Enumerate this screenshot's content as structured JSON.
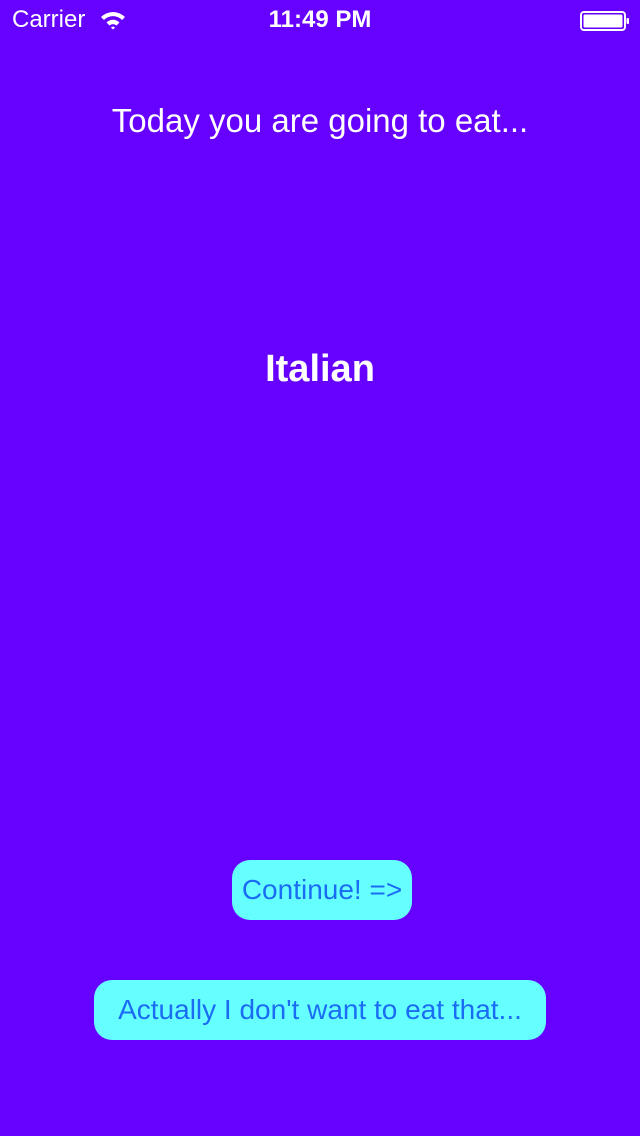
{
  "status_bar": {
    "carrier": "Carrier",
    "time": "11:49 PM",
    "wifi_icon": "wifi-icon",
    "battery_icon": "battery-icon"
  },
  "main": {
    "headline": "Today you are going to eat...",
    "cuisine": "Italian"
  },
  "buttons": {
    "continue_label": "Continue! =>",
    "reject_label": "Actually I don't want to eat that..."
  },
  "colors": {
    "background": "#6600ff",
    "button_background": "#66ffff",
    "button_text": "#1a6cf2",
    "text": "#ffffff"
  }
}
